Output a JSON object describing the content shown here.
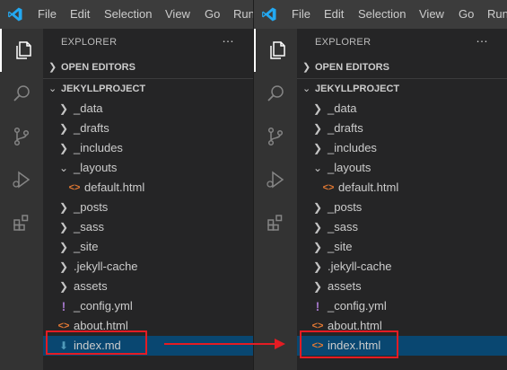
{
  "menu": {
    "left": [
      "File",
      "Edit",
      "Selection",
      "View",
      "Go",
      "Run"
    ],
    "right": [
      "File",
      "Edit",
      "Selection",
      "View",
      "Go",
      "Run"
    ]
  },
  "explorer": {
    "title": "EXPLORER",
    "more": "…",
    "open_editors": "OPEN EDITORS",
    "project": "JEKYLLPROJECT"
  },
  "tree_left": [
    {
      "name": "_data",
      "icon": "chevron-right",
      "indent": 1
    },
    {
      "name": "_drafts",
      "icon": "chevron-right",
      "indent": 1
    },
    {
      "name": "_includes",
      "icon": "chevron-right",
      "indent": 1
    },
    {
      "name": "_layouts",
      "icon": "chevron-down",
      "indent": 1
    },
    {
      "name": "default.html",
      "icon": "html",
      "indent": 2
    },
    {
      "name": "_posts",
      "icon": "chevron-right",
      "indent": 1
    },
    {
      "name": "_sass",
      "icon": "chevron-right",
      "indent": 1
    },
    {
      "name": "_site",
      "icon": "chevron-right",
      "indent": 1
    },
    {
      "name": ".jekyll-cache",
      "icon": "chevron-right",
      "indent": 1
    },
    {
      "name": "assets",
      "icon": "chevron-right",
      "indent": 1
    },
    {
      "name": "_config.yml",
      "icon": "yml",
      "indent": 1
    },
    {
      "name": "about.html",
      "icon": "html",
      "indent": 1
    },
    {
      "name": "index.md",
      "icon": "md",
      "indent": 1,
      "selected": true
    }
  ],
  "tree_right": [
    {
      "name": "_data",
      "icon": "chevron-right",
      "indent": 1
    },
    {
      "name": "_drafts",
      "icon": "chevron-right",
      "indent": 1
    },
    {
      "name": "_includes",
      "icon": "chevron-right",
      "indent": 1
    },
    {
      "name": "_layouts",
      "icon": "chevron-down",
      "indent": 1
    },
    {
      "name": "default.html",
      "icon": "html",
      "indent": 2
    },
    {
      "name": "_posts",
      "icon": "chevron-right",
      "indent": 1
    },
    {
      "name": "_sass",
      "icon": "chevron-right",
      "indent": 1
    },
    {
      "name": "_site",
      "icon": "chevron-right",
      "indent": 1
    },
    {
      "name": ".jekyll-cache",
      "icon": "chevron-right",
      "indent": 1
    },
    {
      "name": "assets",
      "icon": "chevron-right",
      "indent": 1
    },
    {
      "name": "_config.yml",
      "icon": "yml",
      "indent": 1
    },
    {
      "name": "about.html",
      "icon": "html",
      "indent": 1
    },
    {
      "name": "index.html",
      "icon": "html",
      "indent": 1,
      "selected": true
    }
  ],
  "colors": {
    "selection": "#094771",
    "highlight": "#e51c23",
    "html_icon": "#e37933",
    "yml_icon": "#a074c4",
    "md_icon": "#519aba"
  }
}
